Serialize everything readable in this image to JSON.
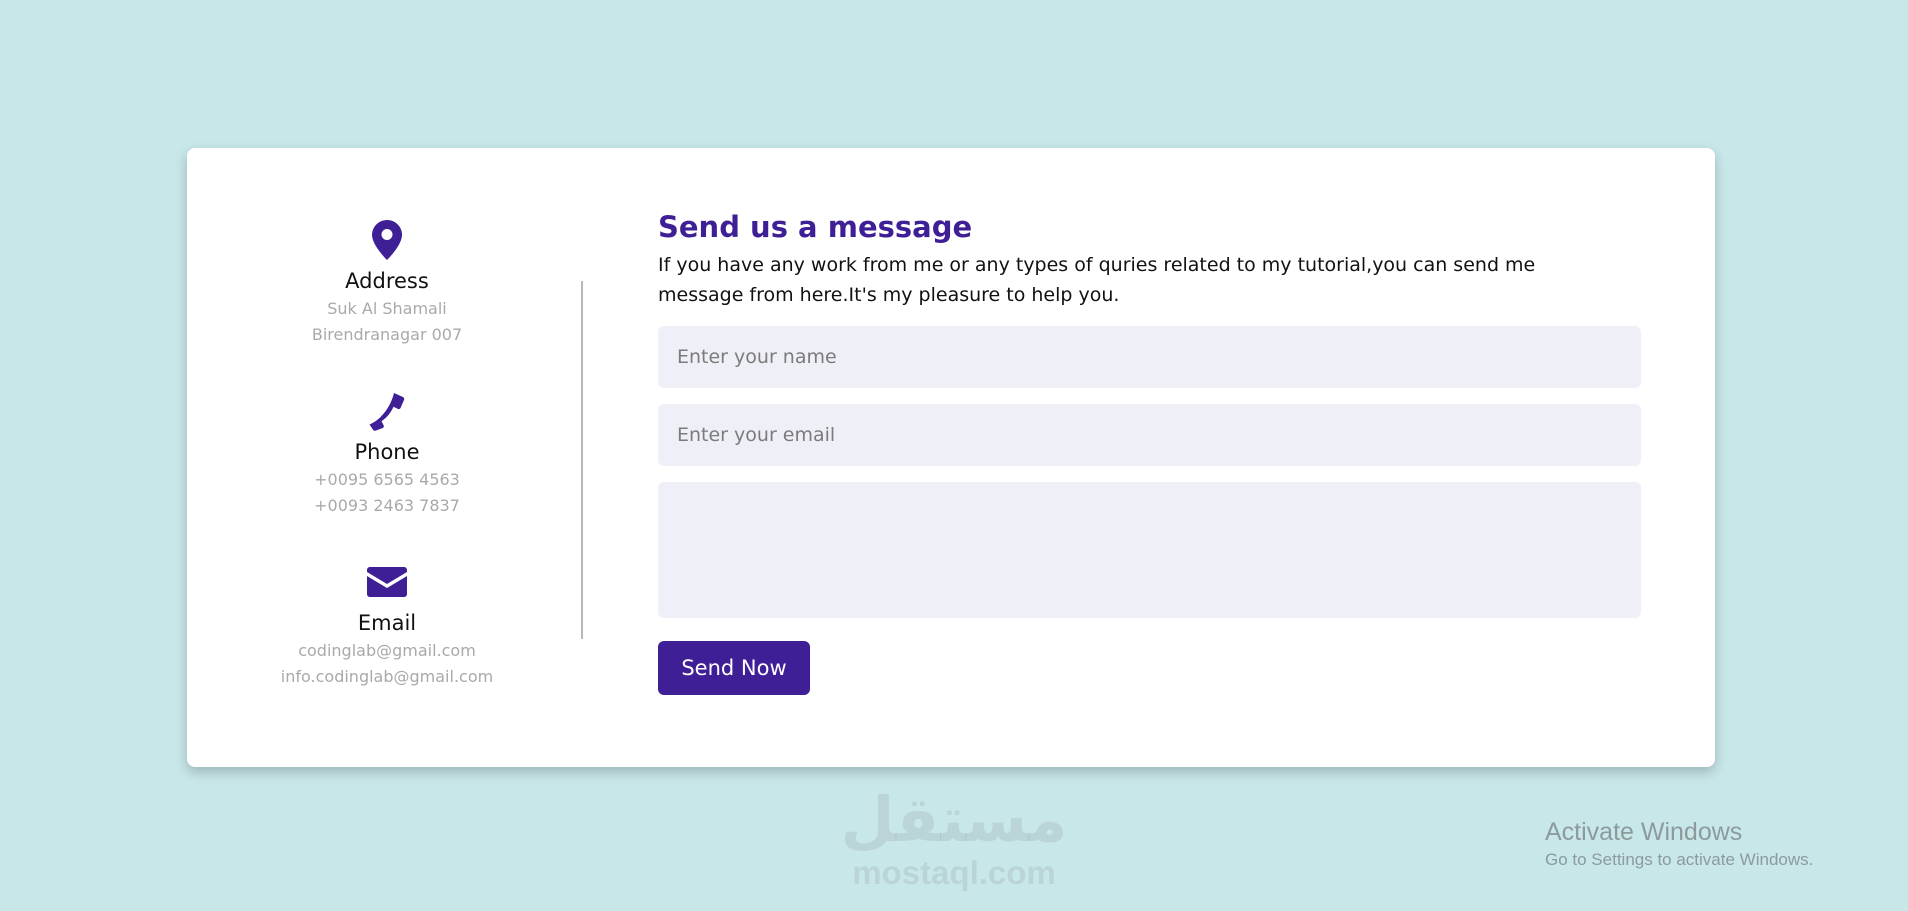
{
  "contact": {
    "address": {
      "icon": "location-pin-icon",
      "title": "Address",
      "lines": [
        "Suk Al Shamali",
        "Birendranagar 007"
      ]
    },
    "phone": {
      "icon": "phone-icon",
      "title": "Phone",
      "lines": [
        "+0095 6565 4563",
        "+0093 2463 7837"
      ]
    },
    "email": {
      "icon": "envelope-icon",
      "title": "Email",
      "lines": [
        "codinglab@gmail.com",
        "info.codinglab@gmail.com"
      ]
    }
  },
  "form": {
    "heading": "Send us a message",
    "description": "If you have any work from me or any types of quries related to my tutorial,you can send me message from here.It's my pleasure to help you.",
    "name_placeholder": "Enter your name",
    "name_value": "",
    "email_placeholder": "Enter your email",
    "email_value": "",
    "message_value": "",
    "send_label": "Send Now"
  },
  "watermark": {
    "arabic": "مستقل",
    "latin": "mostaql.com"
  },
  "windows_notice": {
    "title": "Activate Windows",
    "subtitle": "Go to Settings to activate Windows."
  },
  "colors": {
    "accent": "#3e1f96",
    "background": "#c8e7e9",
    "field_bg": "#eff0f7"
  }
}
